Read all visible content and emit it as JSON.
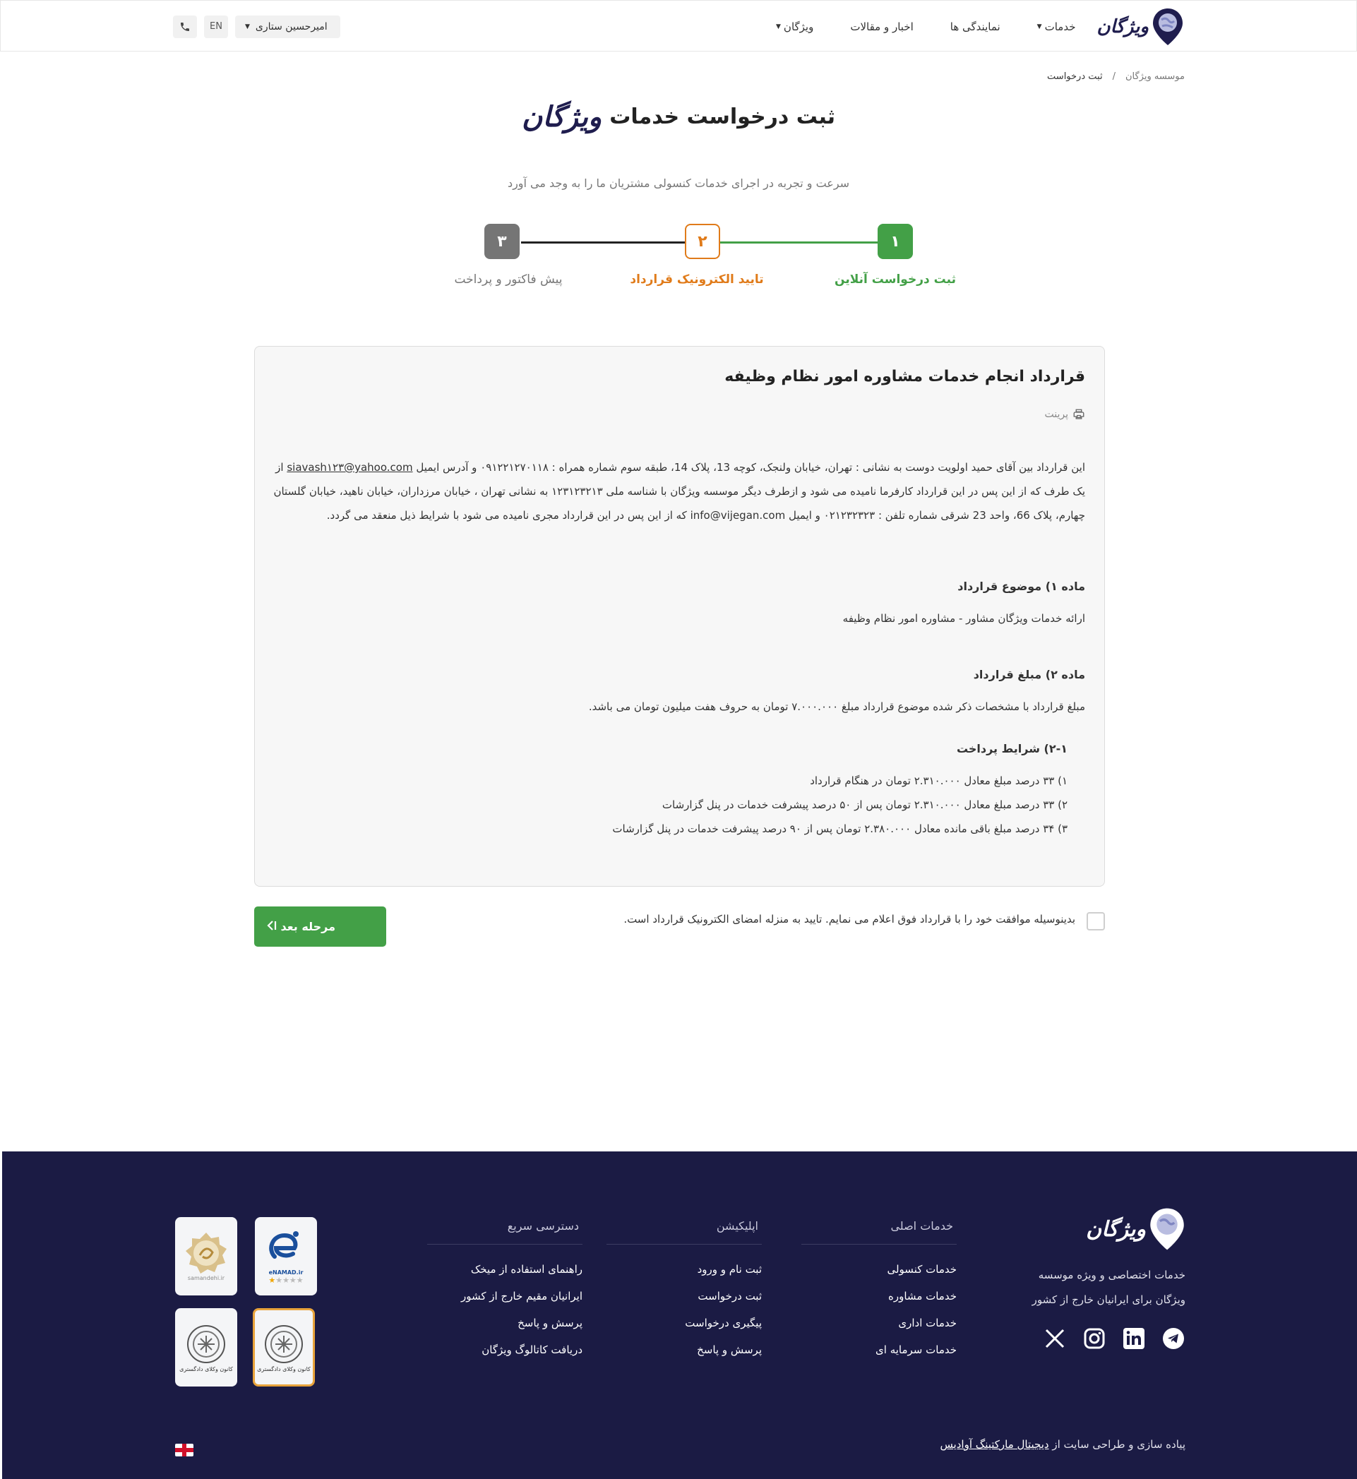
{
  "header": {
    "brand": "ویژگان",
    "nav": [
      {
        "label": "خدمات",
        "has_menu": true
      },
      {
        "label": "نمایندگی ها",
        "has_menu": false
      },
      {
        "label": "اخبار و مقالات",
        "has_menu": false
      },
      {
        "label": "ویژگان",
        "has_menu": true
      }
    ],
    "user_name": "امیرحسین ستاری",
    "lang_button": "EN",
    "phone_icon": "phone-icon"
  },
  "breadcrumb": {
    "home": "موسسه ویژگان",
    "separator": "/",
    "current": "ثبت درخواست"
  },
  "hero": {
    "title": "ثبت درخواست خدمات",
    "brand": "ویژگان",
    "subtitle": "سرعت و تجربه در اجرای خدمات کنسولی مشتریان ما را به وجد می آورد"
  },
  "stepper": {
    "steps": [
      {
        "number": "۱",
        "label": "ثبت درخواست آنلاین",
        "state": "done"
      },
      {
        "number": "۲",
        "label": "تایید الکترونیک قرارداد",
        "state": "active"
      },
      {
        "number": "۳",
        "label": "پیش فاکتور و پرداخت",
        "state": "pending"
      }
    ],
    "colors": {
      "done": "#43a047",
      "active": "#e07b1a",
      "pending": "#757575"
    }
  },
  "contract": {
    "title": "قرارداد انجام خدمات مشاوره امور نظام وظیفه",
    "print_label": "پرینت",
    "intro_1": "این قرارداد بین آقای حمید اولویت دوست به نشانی : تهران، خیابان ولنجک، کوچه 13، پلاک 14، طبقه سوم شماره همراه : ۰۹۱۲۲۱۲۷۰۱۱۸ و آدرس ایمیل",
    "intro_email": "siavash۱۲۳@yahoo.com",
    "intro_2": " از یک طرف که از این پس در این قرارداد کارفرما نامیده می شود و ازطرف دیگر موسسه ویژگان با شناسه ملی ۱۲۳۱۲۳۲۱۳ به نشانی تهران ، خیابان مرزداران، خیابان ناهید، خیابان گلستان چهارم، پلاک 66، واحد 23 شرقی شماره تلفن : ۰۲۱۲۳۲۳۲۳ و ایمیل info@vijegan.com که از این پس در این قرارداد مجری نامیده می شود با شرایط ذیل منعقد می گردد.",
    "article1_title": "ماده ۱) موضوع قرارداد",
    "article1_text": "ارائه خدمات ویژگان مشاور - مشاوره امور نظام وظیفه",
    "article2_title": "ماده ۲) مبلغ قرارداد",
    "article2_text": "مبلغ قرارداد با مشخصات ذکر شده موضوع قرارداد مبلغ ۷.۰۰۰.۰۰۰ تومان به حروف هفت میلیون تومان می باشد.",
    "payment_title": "۲-۱) شرایط پرداخت",
    "payments": [
      "۱) ۳۳ درصد مبلغ معادل ۲.۳۱۰.۰۰۰ تومان در هنگام قرارداد",
      "۲) ۳۳ درصد مبلغ معادل ۲.۳۱۰.۰۰۰ تومان پس از ۵۰ درصد پیشرفت خدمات در پنل گزارشات",
      "۳) ۳۴ درصد مبلغ باقی مانده معادل ۲.۳۸۰.۰۰۰ تومان پس از ۹۰ درصد پیشرفت خدمات در پنل گزارشات"
    ]
  },
  "agreement": {
    "text": "بدینوسیله موافقت خود را با قرارداد فوق اعلام می نمایم. تایید به منزله امضای الکترونیک قرارداد است.",
    "checked": false
  },
  "next_button": {
    "label": "مرحله بعد",
    "icon": "double-chevron-left-icon"
  },
  "footer": {
    "brand": "ویژگان",
    "description_1": "خدمات اختصاصی و ویژه موسسه",
    "description_2": "ویژگان برای ایرانیان خارج از کشور",
    "social": [
      "telegram-icon",
      "linkedin-icon",
      "instagram-icon",
      "x-icon"
    ],
    "col_services": {
      "title": "خدمات اصلی",
      "items": [
        "خدمات کنسولی",
        "خدمات مشاوره",
        "خدمات اداری",
        "خدمات سرمایه ای"
      ]
    },
    "col_app": {
      "title": "اپلیکیشن",
      "items": [
        "ثبت نام و ورود",
        "ثبت درخواست",
        "پیگیری درخواست",
        "پرسش و پاسخ"
      ]
    },
    "col_quick": {
      "title": "دسترسی سریع",
      "items": [
        "راهنمای استفاده از میخک",
        "ایرانیان مقیم خارج از کشور",
        "پرسش و پاسخ",
        "دریافت کاتالوگ ویژگان"
      ]
    },
    "badges": {
      "enamad": "eNAMAD.ir",
      "samandehi": "samandehi.ir",
      "notary_1": "کانون وکلای دادگستری",
      "notary_2": "کانون وکلای دادگستری"
    },
    "credit_prefix": "پیاده سازی و طراحی سایت از ",
    "credit_link": "دیجیتال مارکتینگ آوادیس"
  }
}
